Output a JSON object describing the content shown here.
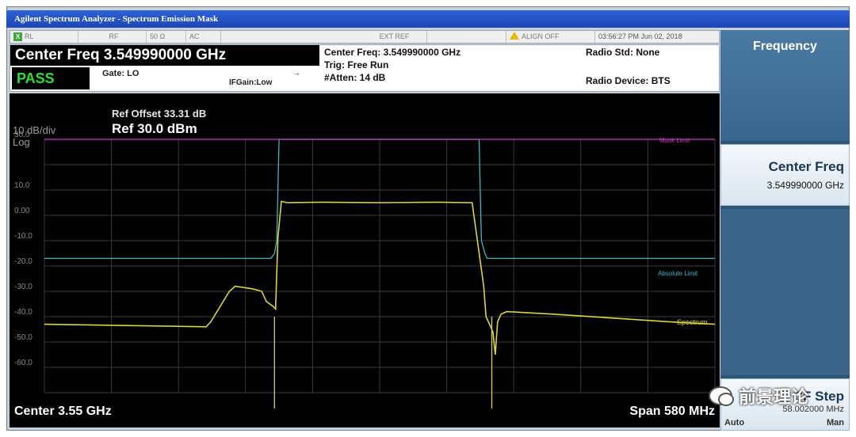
{
  "window": {
    "title": "Agilent Spectrum Analyzer - Spectrum Emission Mask"
  },
  "status_bar": {
    "rl": "RL",
    "coupling": "RF",
    "impedance": "50 Ω",
    "ac": "AC",
    "ext_ref": "EXT REF",
    "align": "ALIGN OFF",
    "datetime": "03:56:27 PM Jun 02, 2018"
  },
  "measurement_info": {
    "center_freq_banner": "Center Freq 3.549990000 GHz",
    "pass": "PASS",
    "gate": "Gate: LO",
    "ifgain": "IFGain:Low",
    "center_freq": "Center Freq: 3.549990000 GHz",
    "trig": "Trig: Free Run",
    "atten": "#Atten: 14 dB",
    "radio_std": "Radio Std: None",
    "radio_device": "Radio Device: BTS"
  },
  "plot": {
    "ref_offset": "Ref Offset 33.31 dB",
    "ref_level": "Ref 30.0 dBm",
    "scale": "10 dB/div",
    "scale_type": "Log",
    "center": "Center  3.55 GHz",
    "span": "Span 580 MHz",
    "labels": {
      "mask_upper": "Mask Limit",
      "abs_limit": "Absolute Limit",
      "spectrum": "Spectrum"
    },
    "colors": {
      "mask": "#c23fc2",
      "limit": "#3bb6c7",
      "trace": "#d8d83a",
      "grid": "#3a3a3a",
      "bg": "#000000"
    }
  },
  "chart_data": {
    "type": "line",
    "xlabel": "",
    "ylabel": "",
    "x_unit": "GHz",
    "y_unit": "dBm",
    "xlim": [
      3.26,
      3.84
    ],
    "ylim": [
      -70,
      30
    ],
    "yticks": [
      "30.0",
      "10.0",
      "0.00",
      "-10.0",
      "-20.0",
      "-30.0",
      "-40.0",
      "-50.0",
      "-60.0"
    ],
    "series": [
      {
        "name": "Spectrum",
        "color": "#d8d83a",
        "x": [
          3.26,
          3.4,
          3.404,
          3.42,
          3.425,
          3.44,
          3.448,
          3.452,
          3.458,
          3.46,
          3.462,
          3.465,
          3.47,
          3.5,
          3.55,
          3.6,
          3.63,
          3.64,
          3.642,
          3.645,
          3.648,
          3.65,
          3.652,
          3.655,
          3.66,
          3.7,
          3.8,
          3.84
        ],
        "y": [
          -43,
          -44,
          -42,
          -30,
          -28,
          -29,
          -30,
          -34,
          -36,
          -37,
          -9,
          5.5,
          5,
          5.2,
          5,
          5.2,
          5,
          -28,
          -40,
          -43,
          -46,
          -55,
          -42,
          -39,
          -38,
          -39,
          -42,
          -43
        ]
      },
      {
        "name": "Absolute Limit",
        "color": "#3bb6c7",
        "x": [
          3.26,
          3.456,
          3.459,
          3.461,
          3.463,
          3.636,
          3.638,
          3.641,
          3.643,
          3.84
        ],
        "y": [
          -17,
          -17,
          -15,
          -10,
          30,
          30,
          -10,
          -15,
          -17,
          -17
        ]
      },
      {
        "name": "Mask Limit",
        "color": "#c23fc2",
        "x": [
          3.26,
          3.84
        ],
        "y": [
          30,
          30
        ]
      }
    ]
  },
  "softkeys": {
    "menu_title": "Frequency",
    "center_freq_label": "Center Freq",
    "center_freq_value": "3.549990000 GHz",
    "step_label": "CF Step",
    "step_value": "58.002000 MHz",
    "auto": "Auto",
    "man": "Man"
  },
  "watermark": {
    "text": "前景理论",
    "icon": "wechat-icon"
  }
}
